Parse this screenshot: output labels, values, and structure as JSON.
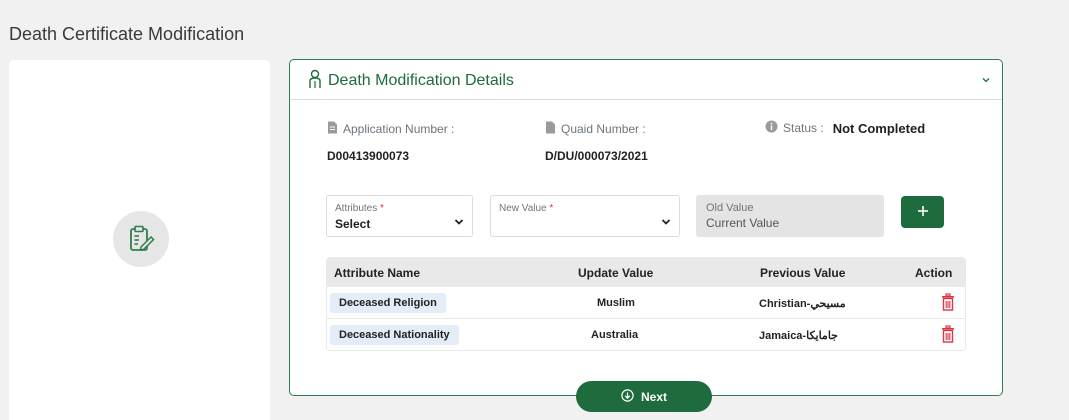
{
  "page": {
    "title": "Death Certificate Modification"
  },
  "card": {
    "title": "Death Modification Details"
  },
  "info": {
    "application_label": "Application Number :",
    "application_value": "D00413900073",
    "quaid_label": "Quaid Number :",
    "quaid_value": "D/DU/000073/2021",
    "status_label": "Status :",
    "status_value": "Not Completed"
  },
  "form": {
    "attributes_label": "Attributes",
    "required_mark": "*",
    "attributes_value": "Select",
    "new_value_label": "New Value",
    "old_value_label": "Old Value",
    "old_value_value": "Current Value"
  },
  "table": {
    "headers": [
      "Attribute Name",
      "Update Value",
      "Previous Value",
      "Action"
    ],
    "rows": [
      {
        "attribute": "Deceased Religion",
        "update": "Muslim",
        "previous": "Christian-مسيحي"
      },
      {
        "attribute": "Deceased Nationality",
        "update": "Australia",
        "previous": "Jamaica-جامايكا"
      }
    ]
  },
  "buttons": {
    "next_label": "Next",
    "add_label": "+"
  },
  "colors": {
    "brand_green": "#1e6b3e",
    "delete_red": "#dc3545",
    "chip_blue": "#e3ecf7"
  },
  "icons": [
    "user-icon",
    "chevron-down-icon",
    "document-icon",
    "info-icon",
    "plus-icon",
    "trash-icon",
    "arrow-down-circle-icon",
    "clipboard-edit-icon"
  ]
}
